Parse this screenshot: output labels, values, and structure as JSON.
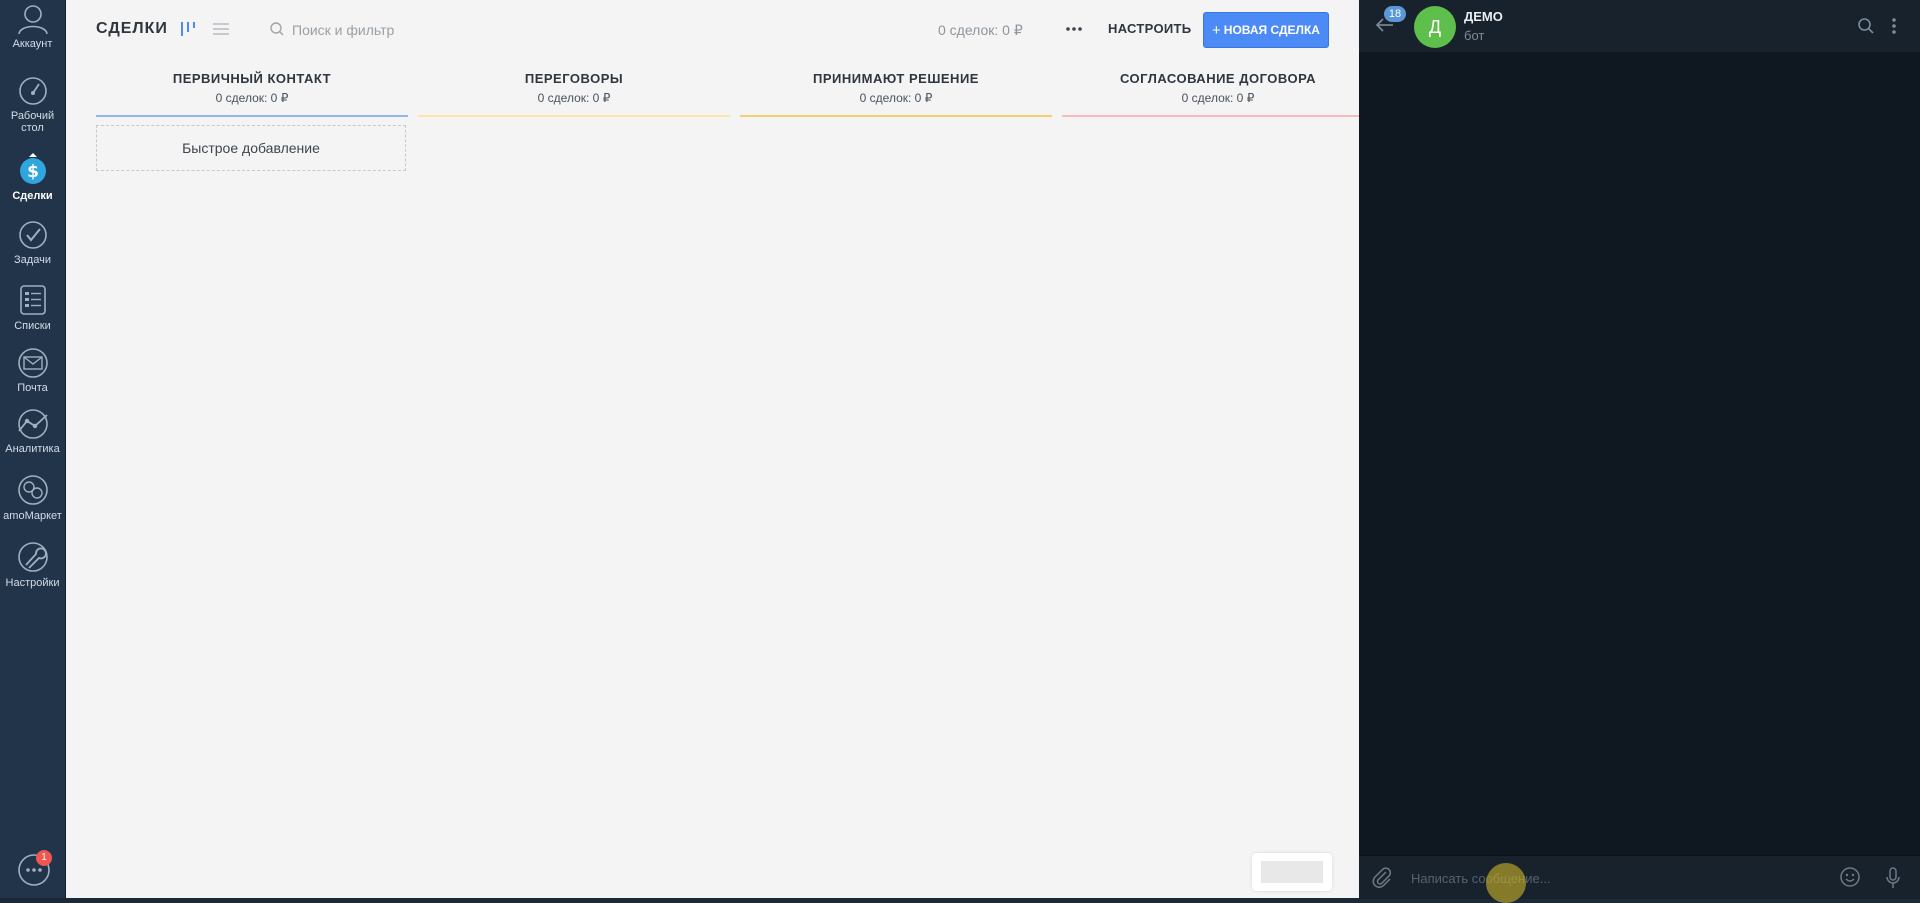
{
  "sidebar": {
    "items": [
      {
        "label": "Аккаунт",
        "icon": "user-icon"
      },
      {
        "label": "Рабочий стол",
        "icon": "dashboard-icon"
      },
      {
        "label": "Сделки",
        "icon": "deals-icon"
      },
      {
        "label": "Задачи",
        "icon": "tasks-icon"
      },
      {
        "label": "Списки",
        "icon": "lists-icon"
      },
      {
        "label": "Почта",
        "icon": "mail-icon"
      },
      {
        "label": "Аналитика",
        "icon": "analytics-icon"
      },
      {
        "label": "amoМаркет",
        "icon": "market-icon"
      },
      {
        "label": "Настройки",
        "icon": "settings-icon"
      }
    ],
    "chat_badge": "1"
  },
  "header": {
    "title": "СДЕЛКИ",
    "search_placeholder": "Поиск и фильтр",
    "summary": "0 сделок: 0 ₽",
    "settings_label": "НАСТРОИТЬ",
    "new_deal_label": "НОВАЯ СДЕЛКА",
    "new_deal_plus": "+"
  },
  "pipeline": {
    "columns": [
      {
        "title": "ПЕРВИЧНЫЙ КОНТАКТ",
        "summary": "0 сделок: 0 ₽",
        "color": "#8fb9ee"
      },
      {
        "title": "ПЕРЕГОВОРЫ",
        "summary": "0 сделок: 0 ₽",
        "color": "#fbe7a6"
      },
      {
        "title": "ПРИНИМАЮТ РЕШЕНИЕ",
        "summary": "0 сделок: 0 ₽",
        "color": "#f5cf72"
      },
      {
        "title": "СОГЛАСОВАНИЕ ДОГОВОРА",
        "summary": "0 сделок: 0 ₽",
        "color": "#f6bcbc"
      }
    ],
    "quick_add": "Быстрое добавление"
  },
  "chat": {
    "unread_badge": "18",
    "avatar_letter": "Д",
    "name": "ДЕМО",
    "status": "бот",
    "composer_placeholder": "Написать сообщение..."
  },
  "colors": {
    "sidebar_bg": "#223449",
    "accent_blue": "#4c8bf5",
    "chat_bg": "#0f1721",
    "avatar_green": "#5fbf4c"
  }
}
